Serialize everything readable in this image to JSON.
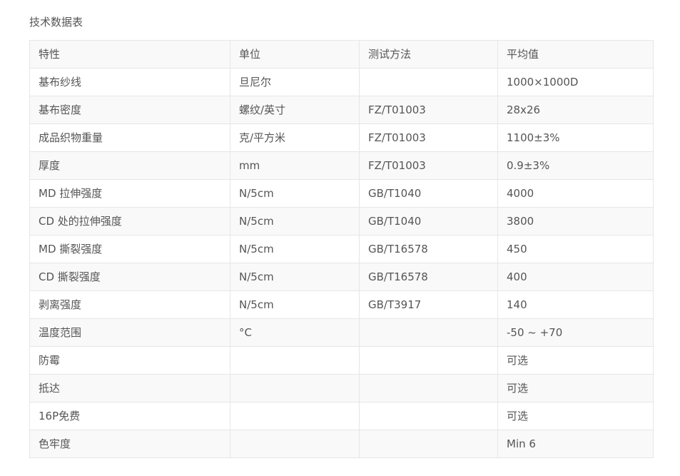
{
  "title": "技术数据表",
  "table": {
    "rows": [
      [
        "特性",
        "单位",
        "测试方法",
        "平均值"
      ],
      [
        "基布纱线",
        "旦尼尔",
        "",
        "1000×1000D"
      ],
      [
        "基布密度",
        "螺纹/英寸",
        "FZ/T01003",
        "28x26"
      ],
      [
        "成品织物重量",
        "克/平方米",
        "FZ/T01003",
        "1100±3%"
      ],
      [
        "厚度",
        "mm",
        "FZ/T01003",
        "0.9±3%"
      ],
      [
        "MD 拉伸强度",
        "N/5cm",
        "GB/T1040",
        "4000"
      ],
      [
        "CD 处的拉伸强度",
        "N/5cm",
        "GB/T1040",
        "3800"
      ],
      [
        "MD 撕裂强度",
        "N/5cm",
        "GB/T16578",
        "450"
      ],
      [
        "CD 撕裂强度",
        "N/5cm",
        "GB/T16578",
        "400"
      ],
      [
        "剥离强度",
        "N/5cm",
        "GB/T3917",
        "140"
      ],
      [
        "温度范围",
        "°C",
        "",
        "-50 ~ +70"
      ],
      [
        "防霉",
        "",
        "",
        "可选"
      ],
      [
        "抵达",
        "",
        "",
        "可选"
      ],
      [
        "16P免费",
        "",
        "",
        "可选"
      ],
      [
        "色牢度",
        "",
        "",
        "Min 6"
      ]
    ]
  }
}
